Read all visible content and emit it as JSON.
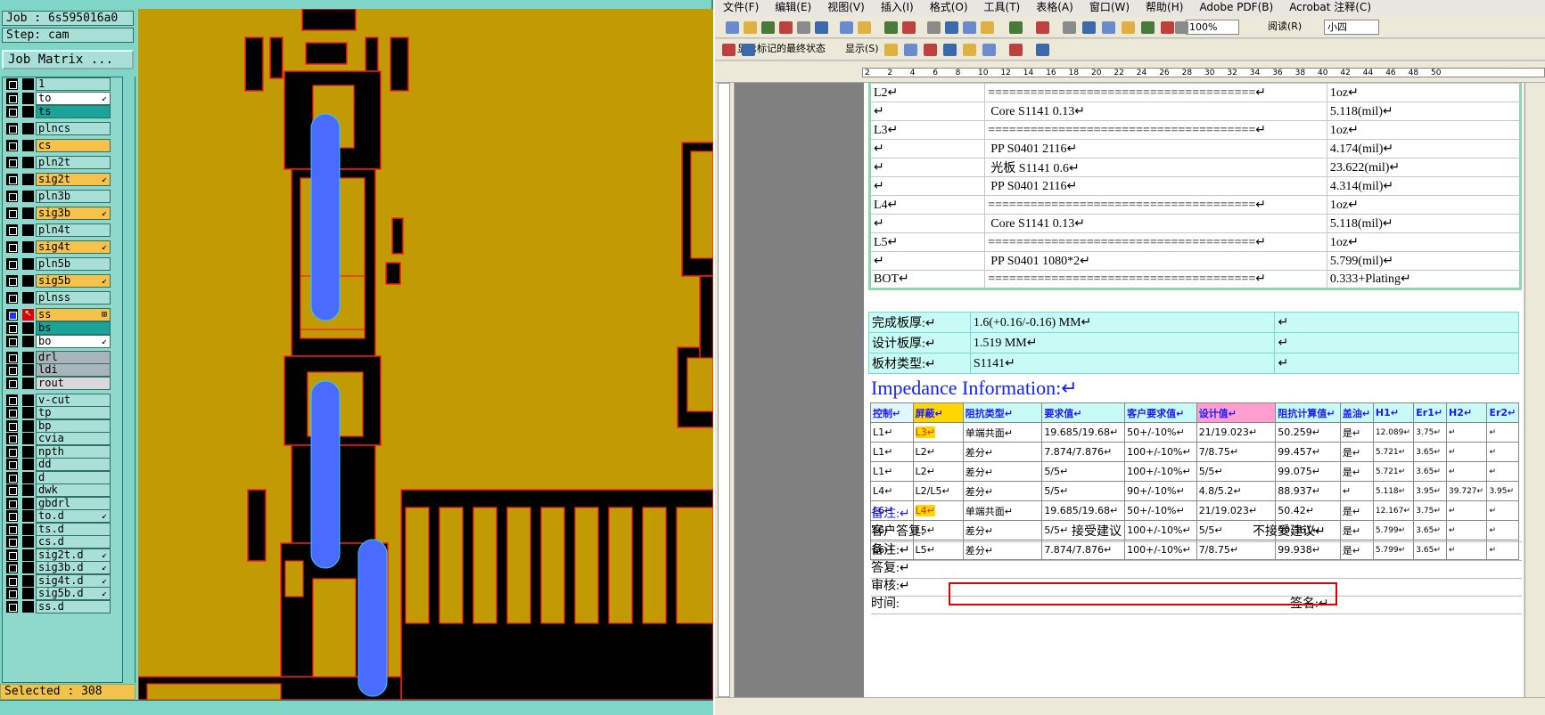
{
  "cam": {
    "job": "Job : 6s595016a0",
    "step": "Step: cam",
    "job_matrix": "Job Matrix ...",
    "selected": "Selected : 308",
    "layers": [
      {
        "name": "1",
        "color": "c-teal0"
      },
      {
        "name": "to",
        "color": "c-white",
        "mark": "↙"
      },
      {
        "name": "ts",
        "color": "c-teal"
      },
      {
        "name": "plncs",
        "color": ""
      },
      {
        "name": "cs",
        "color": "c-orange"
      },
      {
        "name": "pln2t",
        "color": ""
      },
      {
        "name": "sig2t",
        "color": "c-orange",
        "mark": "↙"
      },
      {
        "name": "pln3b",
        "color": ""
      },
      {
        "name": "sig3b",
        "color": "c-orange",
        "mark": "↙"
      },
      {
        "name": "pln4t",
        "color": ""
      },
      {
        "name": "sig4t",
        "color": "c-orange",
        "mark": "↙"
      },
      {
        "name": "pln5b",
        "color": ""
      },
      {
        "name": "sig5b",
        "color": "c-orange",
        "mark": "↙"
      },
      {
        "name": "plnss",
        "color": ""
      },
      {
        "name": "ss",
        "color": "c-orange",
        "active": true,
        "mark": "⊞"
      },
      {
        "name": "bs",
        "color": "c-green"
      },
      {
        "name": "bo",
        "color": "c-white",
        "mark": "↙"
      },
      {
        "name": "drl",
        "color": "c-gray"
      },
      {
        "name": "ldi",
        "color": "c-gray"
      },
      {
        "name": "rout",
        "color": "c-lgray"
      },
      {
        "name": "v-cut",
        "color": ""
      },
      {
        "name": "tp",
        "color": ""
      },
      {
        "name": "bp",
        "color": ""
      },
      {
        "name": "cvia",
        "color": ""
      },
      {
        "name": "npth",
        "color": ""
      },
      {
        "name": "dd",
        "color": ""
      },
      {
        "name": "d",
        "color": ""
      },
      {
        "name": "dwk",
        "color": ""
      },
      {
        "name": "gbdrl",
        "color": ""
      },
      {
        "name": "to.d",
        "color": "",
        "mark": "↙"
      },
      {
        "name": "ts.d",
        "color": ""
      },
      {
        "name": "cs.d",
        "color": ""
      },
      {
        "name": "sig2t.d",
        "color": "",
        "mark": "↙"
      },
      {
        "name": "sig3b.d",
        "color": "",
        "mark": "↙"
      },
      {
        "name": "sig4t.d",
        "color": "",
        "mark": "↙"
      },
      {
        "name": "sig5b.d",
        "color": "",
        "mark": "↙"
      },
      {
        "name": "ss.d",
        "color": ""
      }
    ]
  },
  "word": {
    "menu": [
      "文件(F)",
      "编辑(E)",
      "视图(V)",
      "插入(I)",
      "格式(O)",
      "工具(T)",
      "表格(A)",
      "窗口(W)",
      "帮助(H)",
      "Adobe PDF(B)",
      "Acrobat 注释(C)"
    ],
    "zoom": "100%",
    "read_btn": "阅读(R)",
    "font_size": "小四",
    "markup_state": "显示标记的最终状态",
    "show_btn": "显示(S)",
    "ruler_ticks": [
      "2",
      "2",
      "4",
      "6",
      "8",
      "10",
      "12",
      "14",
      "16",
      "18",
      "20",
      "22",
      "24",
      "26",
      "28",
      "30",
      "32",
      "34",
      "36",
      "38",
      "40",
      "42",
      "44",
      "46",
      "48",
      "50"
    ],
    "stack_rows": [
      [
        "L2↵",
        "======================================↵",
        "1oz↵"
      ],
      [
        "↵",
        "Core      S1141     0.13↵",
        "5.118(mil)↵"
      ],
      [
        "L3↵",
        "======================================↵",
        "1oz↵"
      ],
      [
        "↵",
        "PP      S0401     2116↵",
        "4.174(mil)↵"
      ],
      [
        "↵",
        "光板      S1141     0.6↵",
        "23.622(mil)↵"
      ],
      [
        "↵",
        "PP      S0401     2116↵",
        "4.314(mil)↵"
      ],
      [
        "L4↵",
        "======================================↵",
        "1oz↵"
      ],
      [
        "↵",
        "Core      S1141     0.13↵",
        "5.118(mil)↵"
      ],
      [
        "L5↵",
        "======================================↵",
        "1oz↵"
      ],
      [
        "↵",
        "PP      S0401     1080*2↵",
        "5.799(mil)↵"
      ],
      [
        "BOT↵",
        "======================================↵",
        "0.333+Plating↵"
      ]
    ],
    "finish_rows": [
      [
        "完成板厚:↵",
        "1.6(+0.16/-0.16) MM↵",
        "↵"
      ],
      [
        "设计板厚:↵",
        "1.519 MM↵",
        "↵"
      ],
      [
        "板材类型:↵",
        "S1141↵",
        "↵"
      ]
    ],
    "imp_title": "Impedance Information:↵",
    "imp_headers": [
      "控制↵",
      "屏蔽↵",
      "阻抗类型↵",
      "要求值↵",
      "客户要求值↵",
      "设计值↵",
      "阻抗计算值↵",
      "盖油↵",
      "H1↵",
      "Er1↵",
      "H2↵",
      "Er2↵"
    ],
    "imp_rows": [
      [
        "L1↵",
        "L3↵",
        "单端共面↵",
        "19.685/19.68↵",
        "50+/-10%↵",
        "21/19.023↵",
        "50.259↵",
        "是↵",
        "12.089↵",
        "3.75↵",
        "↵",
        "↵"
      ],
      [
        "L1↵",
        "L2↵",
        "差分↵",
        "7.874/7.876↵",
        "100+/-10%↵",
        "7/8.75↵",
        "99.457↵",
        "是↵",
        "5.721↵",
        "3.65↵",
        "↵",
        "↵"
      ],
      [
        "L1↵",
        "L2↵",
        "差分↵",
        "5/5↵",
        "100+/-10%↵",
        "5/5↵",
        "99.075↵",
        "是↵",
        "5.721↵",
        "3.65↵",
        "↵",
        "↵"
      ],
      [
        "L4↵",
        "L2/L5↵",
        "差分↵",
        "5/5↵",
        "90+/-10%↵",
        "4.8/5.2↵",
        "88.937↵",
        "↵",
        "5.118↵",
        "3.95↵",
        "39.727↵",
        "3.95↵"
      ],
      [
        "L6↵",
        "L4↵",
        "单端共面↵",
        "19.685/19.68↵",
        "50+/-10%↵",
        "21/19.023↵",
        "50.42↵",
        "是↵",
        "12.167↵",
        "3.75↵",
        "↵",
        "↵"
      ],
      [
        "L6↵",
        "L5↵",
        "差分↵",
        "5/5↵",
        "100+/-10%↵",
        "5/5↵",
        "99.361↵",
        "是↵",
        "5.799↵",
        "3.65↵",
        "↵",
        "↵"
      ],
      [
        "L6↵",
        "L5↵",
        "差分↵",
        "7.874/7.876↵",
        "100+/-10%↵",
        "7/8.75↵",
        "99.938↵",
        "是↵",
        "5.799↵",
        "3.65↵",
        "↵",
        "↵"
      ]
    ],
    "note1": "备注:↵",
    "reply": "客户答复:",
    "accept": "接受建议",
    "reject": "不接受建议↵",
    "note2": "备注:↵",
    "answer": "答复:↵",
    "review": "审核:↵",
    "time": "时间:",
    "sign": "签名:↵",
    "highlight_color": "#ffd600",
    "redbox_color": "#e00000"
  }
}
